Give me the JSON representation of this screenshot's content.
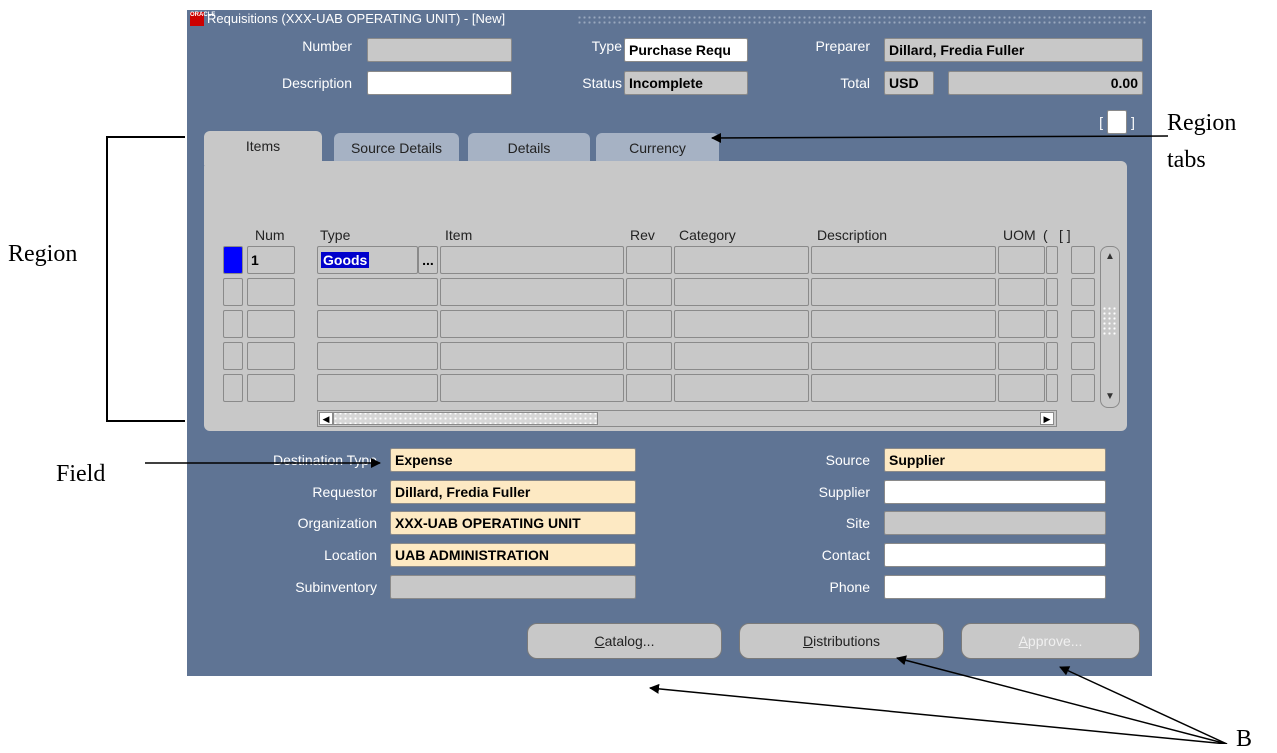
{
  "window": {
    "title": "Requisitions (XXX-UAB OPERATING UNIT) - [New]",
    "logo_text": "ORACLE"
  },
  "header": {
    "number_label": "Number",
    "number_value": "",
    "description_label": "Description",
    "description_value": "",
    "type_label": "Type",
    "type_value": "Purchase Requ",
    "status_label": "Status",
    "status_value": "Incomplete",
    "preparer_label": "Preparer",
    "preparer_value": "Dillard, Fredia Fuller",
    "total_label": "Total",
    "total_currency": "USD",
    "total_value": "0.00",
    "bracket_left": "[",
    "bracket_right": "]"
  },
  "tabs": [
    {
      "label": "Items",
      "active": true
    },
    {
      "label": "Source Details",
      "active": false
    },
    {
      "label": "Details",
      "active": false
    },
    {
      "label": "Currency",
      "active": false
    }
  ],
  "lines": {
    "columns": [
      "Num",
      "Type",
      "Item",
      "Rev",
      "Category",
      "Description",
      "UOM",
      "(",
      "[ ]"
    ],
    "rows": [
      {
        "num": "1",
        "type": "Goods",
        "item": "",
        "rev": "",
        "category": "",
        "description": "",
        "uom": ""
      },
      {
        "num": "",
        "type": "",
        "item": "",
        "rev": "",
        "category": "",
        "description": "",
        "uom": ""
      },
      {
        "num": "",
        "type": "",
        "item": "",
        "rev": "",
        "category": "",
        "description": "",
        "uom": ""
      },
      {
        "num": "",
        "type": "",
        "item": "",
        "rev": "",
        "category": "",
        "description": "",
        "uom": ""
      },
      {
        "num": "",
        "type": "",
        "item": "",
        "rev": "",
        "category": "",
        "description": "",
        "uom": ""
      }
    ],
    "lov_button": "..."
  },
  "details": {
    "destination_type_label": "Destination Type",
    "destination_type_value": "Expense",
    "requestor_label": "Requestor",
    "requestor_value": "Dillard, Fredia Fuller",
    "organization_label": "Organization",
    "organization_value": "XXX-UAB OPERATING UNIT",
    "location_label": "Location",
    "location_value": "UAB ADMINISTRATION",
    "subinventory_label": "Subinventory",
    "subinventory_value": "",
    "source_label": "Source",
    "source_value": "Supplier",
    "supplier_label": "Supplier",
    "supplier_value": "",
    "site_label": "Site",
    "site_value": "",
    "contact_label": "Contact",
    "contact_value": "",
    "phone_label": "Phone",
    "phone_value": ""
  },
  "buttons": {
    "catalog_u": "C",
    "catalog_rest": "atalog...",
    "distributions_u": "D",
    "distributions_rest": "istributions",
    "approve_u": "A",
    "approve_rest": "pprove..."
  },
  "annotations": {
    "region": "Region",
    "region_tabs_1": "Region",
    "region_tabs_2": "tabs",
    "field": "Field",
    "buttons_partial": "B"
  },
  "colors": {
    "window_bg": "#5f7494",
    "field_gray": "#c8c8c8",
    "field_required": "#fde9c3",
    "cursor_blue": "#0000ff"
  }
}
